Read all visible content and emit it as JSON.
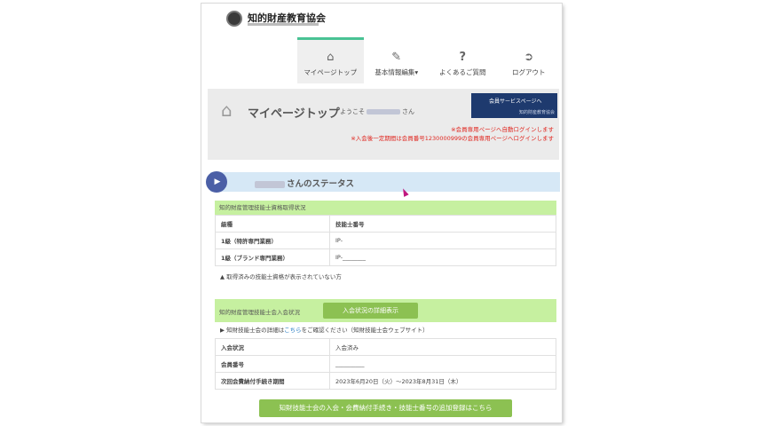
{
  "header": {
    "org_name": "知的財産教育協会"
  },
  "nav": {
    "items": [
      {
        "label": "マイページトップ",
        "icon": "home-icon"
      },
      {
        "label": "基本情報編集▾",
        "icon": "edit-icon"
      },
      {
        "label": "よくあるご質問",
        "icon": "question-icon"
      },
      {
        "label": "ログアウト",
        "icon": "logout-icon"
      }
    ]
  },
  "hero": {
    "title": "マイページトップ",
    "welcome_prefix": "ようこそ",
    "welcome_suffix": "さん",
    "member_button": "会員サービスページへ",
    "member_button_sub": "知的財産教育協会",
    "notice1": "※会員専用ページへ自動ログインします",
    "notice2": "※入会後一定期間は会員番号1230000999の会員専用ページへログインします"
  },
  "status": {
    "title_suffix": "さんのステータス"
  },
  "qualification": {
    "header": "知的財産管理技能士資格取得状況",
    "col1": "級種",
    "col2": "技能士番号",
    "rows": [
      {
        "grade": "1級（特許専門業務）",
        "number": "IP-"
      },
      {
        "grade": "1級（ブランド専門業務）",
        "number": "IP-________"
      }
    ],
    "note": "▲ 取得済みの技能士資格が表示されていない方"
  },
  "membership": {
    "header": "知的財産管理技能士会入会状況",
    "detail_button": "入会状況の詳細表示",
    "info_prefix": "▶ 知財技能士会の詳細は",
    "info_link": "こちら",
    "info_suffix": "をご確認ください（知財技能士会ウェブサイト）",
    "rows": [
      {
        "label": "入会状況",
        "value": "入会済み"
      },
      {
        "label": "会員番号",
        "value": "__________"
      },
      {
        "label": "次回会費納付手続き期間",
        "value": "2023年6月20日（火）～2023年8月31日（木）"
      }
    ]
  },
  "bottom_button": "知財技能士会の入会・会費納付手続き・技能士番号の追加登録はこちら"
}
